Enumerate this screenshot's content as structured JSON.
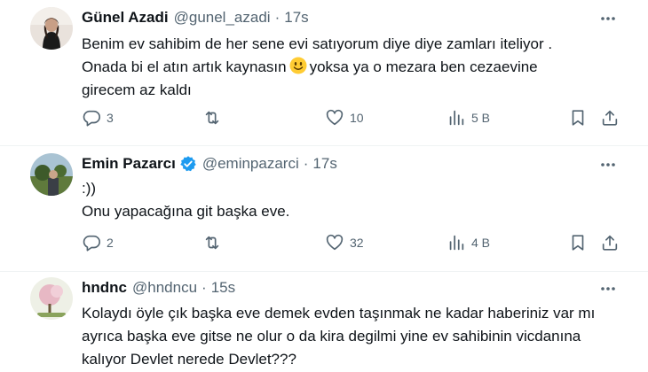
{
  "tweets": [
    {
      "name": "Günel Azadi",
      "handle": "@gunel_azadi",
      "time": "17s",
      "verified": false,
      "lines": [
        {
          "text": "Benim ev sahibim de her sene evi satıyorum diye diye zamları iteliyor ."
        },
        {
          "before": "Onada bi el atın artık kaynasın",
          "emoji": "smiling-face",
          "after": "yoksa ya o mezara ben cezaevine"
        },
        {
          "text": "girecem az kaldı"
        }
      ],
      "replies": "3",
      "retweets": "",
      "likes": "10",
      "views": "5 B"
    },
    {
      "name": "Emin Pazarcı",
      "handle": "@eminpazarci",
      "time": "17s",
      "verified": true,
      "lines": [
        {
          "text": ":))"
        },
        {
          "text": "Onu yapacağına git başka eve."
        }
      ],
      "replies": "2",
      "retweets": "",
      "likes": "32",
      "views": "4 B"
    },
    {
      "name": "hndnc",
      "handle": "@hndncu",
      "time": "15s",
      "verified": false,
      "lines": [
        {
          "text": "Kolaydı öyle çık başka eve demek evden taşınmak ne kadar haberiniz var mı"
        },
        {
          "text": "ayrıca başka eve gitse ne olur o da kira degilmi yine ev sahibinin vicdanına"
        },
        {
          "text": "kalıyor Devlet nerede Devlet???"
        }
      ]
    }
  ],
  "colors": {
    "text": "#0f1419",
    "secondary": "#536471",
    "verified": "#1d9bf0",
    "divider": "#eff3f4"
  },
  "icons": [
    "more-icon",
    "reply-icon",
    "retweet-icon",
    "like-icon",
    "views-icon",
    "bookmark-icon",
    "share-icon",
    "verified-badge-icon",
    "smiling-face-emoji"
  ]
}
